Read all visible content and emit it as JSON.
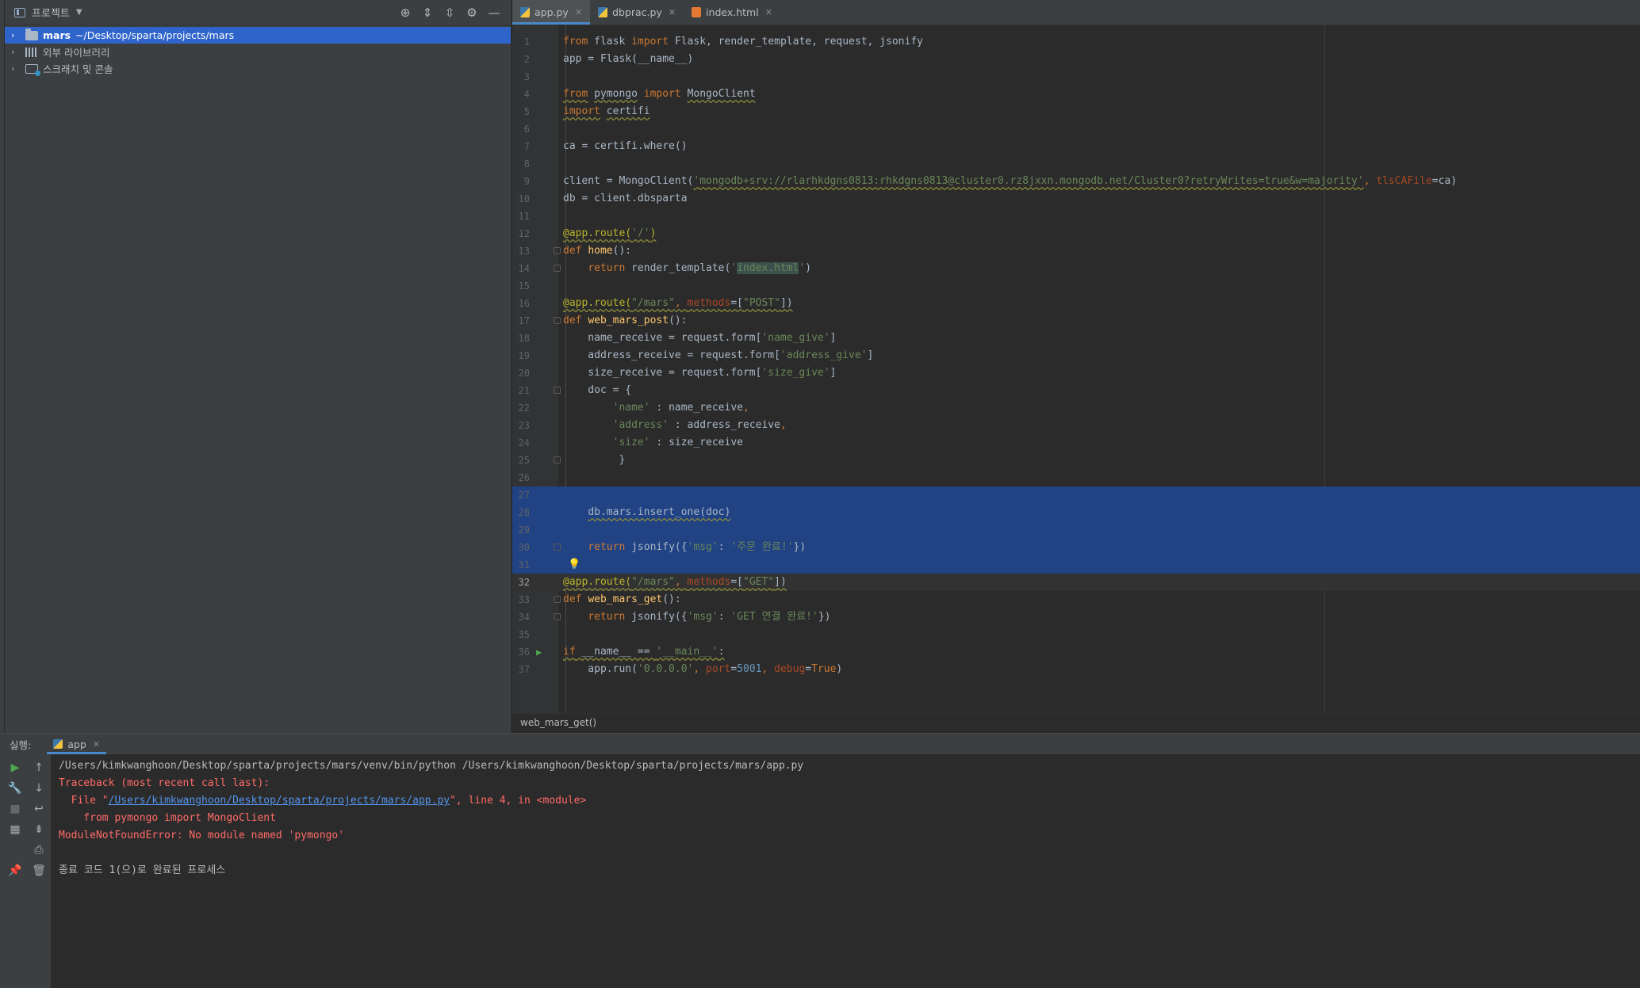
{
  "project_panel": {
    "title": "프로젝트",
    "tree": [
      {
        "name": "mars",
        "path": "~/Desktop/sparta/projects/mars"
      },
      {
        "name": "외부 라이브러리"
      },
      {
        "name": "스크래치 및 콘솔"
      }
    ]
  },
  "editor": {
    "tabs": [
      {
        "label": "app.py"
      },
      {
        "label": "dbprac.py"
      },
      {
        "label": "index.html"
      }
    ],
    "lines": [
      [
        [
          "kw",
          "from"
        ],
        [
          "t",
          " flask "
        ],
        [
          "kw",
          "import"
        ],
        [
          "t",
          " Flask, render_template, request, jsonify"
        ]
      ],
      [
        [
          "t",
          "app = Flask(__name__)"
        ]
      ],
      [],
      [
        [
          "kw u",
          "from"
        ],
        [
          "t",
          " "
        ],
        [
          "u",
          "pymongo"
        ],
        [
          "t",
          " "
        ],
        [
          "kw",
          "import"
        ],
        [
          "t",
          " "
        ],
        [
          "u",
          "MongoClient"
        ]
      ],
      [
        [
          "kw u",
          "import"
        ],
        [
          "t",
          " "
        ],
        [
          "u",
          "certifi"
        ]
      ],
      [],
      [
        [
          "t",
          "ca = certifi.where()"
        ]
      ],
      [],
      [
        [
          "t",
          "client = MongoClient("
        ],
        [
          "str u",
          "'mongodb+srv://rlarhkdgns0813:rhkdgns0813@cluster0.rz8jxxn.mongodb.net/Cluster0?retryWrites=true&w=majority'"
        ],
        [
          "kw",
          ", "
        ],
        [
          "param",
          "tlsCAFile"
        ],
        [
          "t",
          "=ca)"
        ]
      ],
      [
        [
          "t",
          "db = client.dbsparta"
        ]
      ],
      [],
      [
        [
          "dec u",
          "@app.route("
        ],
        [
          "str u",
          "'/'"
        ],
        [
          "dec u",
          ")"
        ]
      ],
      [
        [
          "kw",
          "def "
        ],
        [
          "fn",
          "home"
        ],
        [
          "t",
          "():"
        ]
      ],
      [
        [
          "t",
          "    "
        ],
        [
          "kw",
          "return"
        ],
        [
          "t",
          " render_template("
        ],
        [
          "str",
          "'"
        ],
        [
          "str hl",
          "index.html"
        ],
        [
          "str",
          "'"
        ],
        [
          "t",
          ")"
        ]
      ],
      [],
      [
        [
          "dec u",
          "@app.route("
        ],
        [
          "str u",
          "\"/mars\""
        ],
        [
          "kw u",
          ", "
        ],
        [
          "param u",
          "methods"
        ],
        [
          "t u",
          "=["
        ],
        [
          "str u",
          "\"POST\""
        ],
        [
          "t u",
          "])"
        ]
      ],
      [
        [
          "kw",
          "def "
        ],
        [
          "fn",
          "web_mars_post"
        ],
        [
          "t",
          "():"
        ]
      ],
      [
        [
          "t",
          "    name_receive = request.form["
        ],
        [
          "str",
          "'name_give'"
        ],
        [
          "t",
          "]"
        ]
      ],
      [
        [
          "t",
          "    address_receive = request.form["
        ],
        [
          "str",
          "'address_give'"
        ],
        [
          "t",
          "]"
        ]
      ],
      [
        [
          "t",
          "    size_receive = request.form["
        ],
        [
          "str",
          "'size_give'"
        ],
        [
          "t",
          "]"
        ]
      ],
      [
        [
          "t",
          "    doc = {"
        ]
      ],
      [
        [
          "t",
          "        "
        ],
        [
          "str",
          "'name'"
        ],
        [
          "t",
          " : name_receive"
        ],
        [
          "kw",
          ","
        ]
      ],
      [
        [
          "t",
          "        "
        ],
        [
          "str",
          "'address'"
        ],
        [
          "t",
          " : address_receive"
        ],
        [
          "kw",
          ","
        ]
      ],
      [
        [
          "t",
          "        "
        ],
        [
          "str",
          "'size'"
        ],
        [
          "t",
          " : size_receive"
        ]
      ],
      [
        [
          "t",
          "         }"
        ]
      ],
      [],
      [],
      [
        [
          "t",
          "    "
        ],
        [
          "u",
          "db.mars.insert_one(doc)"
        ]
      ],
      [],
      [
        [
          "t",
          "    "
        ],
        [
          "kw",
          "return"
        ],
        [
          "t",
          " jsonify({"
        ],
        [
          "str",
          "'msg'"
        ],
        [
          "t",
          ": "
        ],
        [
          "str",
          "'주문 완료!'"
        ],
        [
          "t",
          "})"
        ]
      ],
      [],
      [
        [
          "dec u",
          "@app.route("
        ],
        [
          "str u",
          "\"/mars\""
        ],
        [
          "kw u",
          ", "
        ],
        [
          "param u",
          "methods"
        ],
        [
          "t u",
          "=["
        ],
        [
          "str u",
          "\"GET\""
        ],
        [
          "t u",
          "])"
        ]
      ],
      [
        [
          "kw",
          "def "
        ],
        [
          "fn",
          "web_mars_get"
        ],
        [
          "t",
          "():"
        ]
      ],
      [
        [
          "t",
          "    "
        ],
        [
          "kw",
          "return"
        ],
        [
          "t",
          " jsonify({"
        ],
        [
          "str",
          "'msg'"
        ],
        [
          "t",
          ": "
        ],
        [
          "str",
          "'GET 연결 완료!'"
        ],
        [
          "t",
          "})"
        ]
      ],
      [],
      [
        [
          "kw u",
          "if"
        ],
        [
          "t u",
          " __name__ == "
        ],
        [
          "str u",
          "'__main__'"
        ],
        [
          "t u",
          ":"
        ]
      ],
      [
        [
          "t",
          "    app.run("
        ],
        [
          "str",
          "'0.0.0.0'"
        ],
        [
          "kw",
          ", "
        ],
        [
          "param",
          "port"
        ],
        [
          "t",
          "="
        ],
        [
          "num",
          "5001"
        ],
        [
          "kw",
          ", "
        ],
        [
          "param",
          "debug"
        ],
        [
          "t",
          "="
        ],
        [
          "kw",
          "True"
        ],
        [
          "t",
          ")"
        ]
      ]
    ],
    "breadcrumb": "web_mars_get()"
  },
  "run_panel": {
    "label": "실행:",
    "tab": "app",
    "console": [
      [
        [
          "c-normal",
          "/Users/kimkwanghoon/Desktop/sparta/projects/mars/venv/bin/python /Users/kimkwanghoon/Desktop/sparta/projects/mars/app.py"
        ]
      ],
      [
        [
          "c-err",
          "Traceback (most recent call last):"
        ]
      ],
      [
        [
          "c-err",
          "  File \""
        ],
        [
          "c-link",
          "/Users/kimkwanghoon/Desktop/sparta/projects/mars/app.py"
        ],
        [
          "c-err",
          "\", line 4, in <module>"
        ]
      ],
      [
        [
          "c-err",
          "    from pymongo import MongoClient"
        ]
      ],
      [
        [
          "c-err",
          "ModuleNotFoundError: No module named 'pymongo'"
        ]
      ],
      [],
      [
        [
          "c-normal",
          "종료 코드 1(으)로 완료된 프로세스"
        ]
      ]
    ]
  }
}
